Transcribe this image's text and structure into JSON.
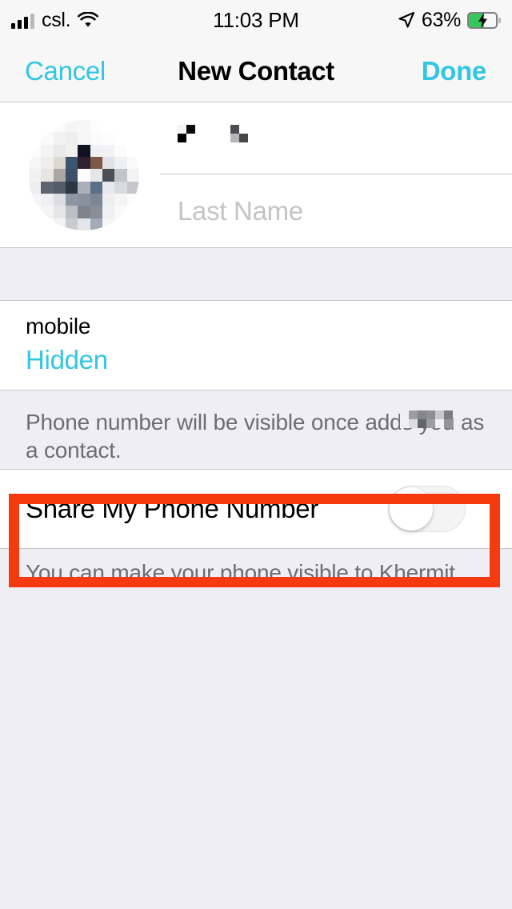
{
  "status_bar": {
    "carrier": "csl.",
    "time": "11:03 PM",
    "battery_percent": "63%",
    "signal_bars_filled": 3,
    "signal_bars_total": 4,
    "icons": [
      "cellular-signal-icon",
      "wifi-icon",
      "location-arrow-icon",
      "battery-charging-icon"
    ],
    "battery_charging": true,
    "battery_fill_color": "#34c759"
  },
  "nav_bar": {
    "cancel_label": "Cancel",
    "title": "New Contact",
    "done_label": "Done"
  },
  "name_section": {
    "avatar": "contact-photo-redacted",
    "first_name_value": "",
    "first_name_redacted": true,
    "last_name_value": "",
    "last_name_placeholder": "Last Name"
  },
  "phone_section": {
    "label": "mobile",
    "value": "Hidden",
    "value_color": "#32c7e0"
  },
  "phone_footer": {
    "text_before": "Phone number will be visible once",
    "text_after": "adds you as a contact.",
    "redacted_name": true,
    "full_text": "Phone number will be visible once adds you as a contact."
  },
  "share_row": {
    "label": "Share My Phone Number",
    "toggle_state": "off",
    "highlighted": true,
    "highlight_color": "#f63a10"
  },
  "share_footer": {
    "text": "You can make your phone visible to Khermit."
  },
  "theme": {
    "accent": "#32c7e0",
    "page_background": "#efeef4",
    "card_background": "#ffffff",
    "separator": "#c8c7cc",
    "secondary_text": "#6d6d72",
    "placeholder_text": "#c4c4c6"
  }
}
